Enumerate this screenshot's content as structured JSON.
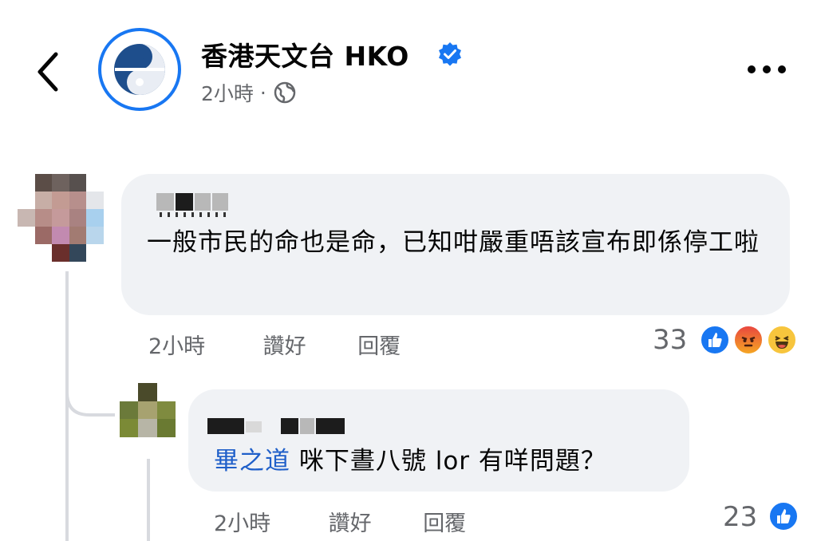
{
  "header": {
    "page_name": "香港天文台 HKO",
    "post_time": "2小時",
    "separator": "·",
    "icons": {
      "back": "chevron-left-icon",
      "verified": "verified-badge-icon",
      "audience": "globe-icon",
      "more": "more-dots-icon"
    }
  },
  "comments": [
    {
      "author_redacted": true,
      "text": "一般市民的命也是命，已知咁嚴重唔該宣布即係停工啦",
      "time": "2小時",
      "like_label": "讚好",
      "reply_label": "回覆",
      "reaction_count": "33",
      "reactions": [
        "like",
        "angry",
        "haha"
      ]
    },
    {
      "author_redacted": true,
      "mention": "畢之道",
      "text": "咪下晝八號 lor 有咩問題？",
      "time": "2小時",
      "like_label": "讚好",
      "reply_label": "回覆",
      "reaction_count": "23",
      "reactions": [
        "like"
      ]
    }
  ],
  "colors": {
    "facebook_blue": "#1877f2",
    "bubble_bg": "#f0f2f5",
    "secondary_text": "#65676b",
    "mention": "#1f5fc9"
  }
}
